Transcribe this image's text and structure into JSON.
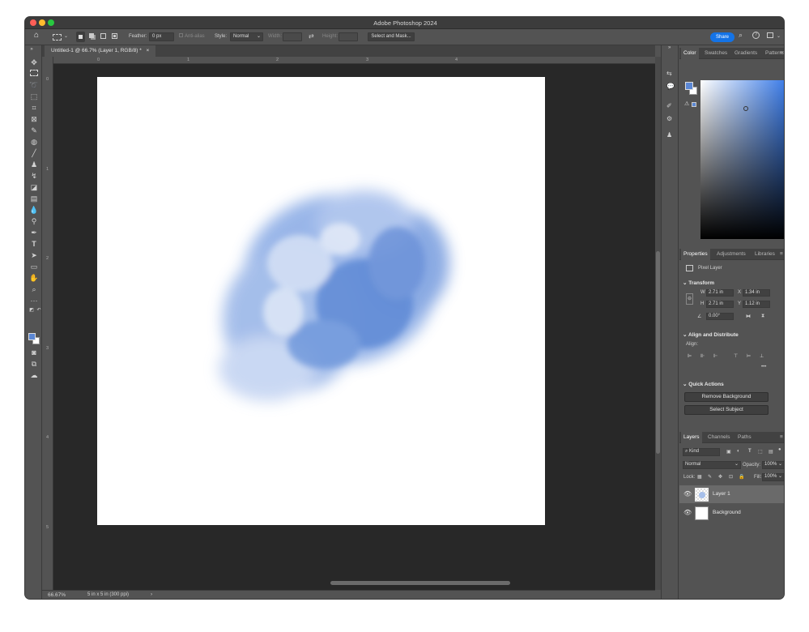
{
  "app": {
    "title": "Adobe Photoshop 2024",
    "share_label": "Share"
  },
  "options": {
    "feather_label": "Feather:",
    "feather_value": "0 px",
    "antialias_label": "Anti-alias",
    "style_label": "Style:",
    "style_value": "Normal",
    "width_label": "Width:",
    "height_label": "Height:",
    "select_mask_label": "Select and Mask..."
  },
  "document": {
    "tab_title": "Untitled-1 @ 66.7% (Layer 1, RGB/8) *",
    "zoom": "66.67%",
    "size_info": "5 in x 5 in (300 ppi)"
  },
  "ruler": {
    "h_ticks": [
      "0",
      "1",
      "2",
      "3",
      "4"
    ],
    "v_ticks": [
      "0",
      "1",
      "2",
      "3",
      "4",
      "5"
    ]
  },
  "color_panel": {
    "tabs": [
      "Color",
      "Swatches",
      "Gradients",
      "Patterns"
    ],
    "foreground": "#5b87d4",
    "background": "#ffffff"
  },
  "properties": {
    "tabs": [
      "Properties",
      "Adjustments",
      "Libraries"
    ],
    "layer_type": "Pixel Layer",
    "transform_title": "Transform",
    "w_label": "W",
    "w_value": "2.71 in",
    "x_label": "X",
    "x_value": "1.34 in",
    "h_label": "H",
    "h_value": "2.71 in",
    "y_label": "Y",
    "y_value": "1.12 in",
    "angle_value": "0.00°",
    "align_title": "Align and Distribute",
    "align_label": "Align:",
    "quick_title": "Quick Actions",
    "remove_bg": "Remove Background",
    "select_subject": "Select Subject"
  },
  "layers_panel": {
    "tabs": [
      "Layers",
      "Channels",
      "Paths"
    ],
    "kind_label": "Kind",
    "blend_mode": "Normal",
    "opacity_label": "Opacity:",
    "opacity_value": "100%",
    "lock_label": "Lock:",
    "fill_label": "Fill:",
    "fill_value": "100%",
    "layers": [
      {
        "name": "Layer 1"
      },
      {
        "name": "Background"
      }
    ]
  },
  "icons": {
    "home": "home-icon",
    "search": "search-icon",
    "help": "help-icon"
  }
}
